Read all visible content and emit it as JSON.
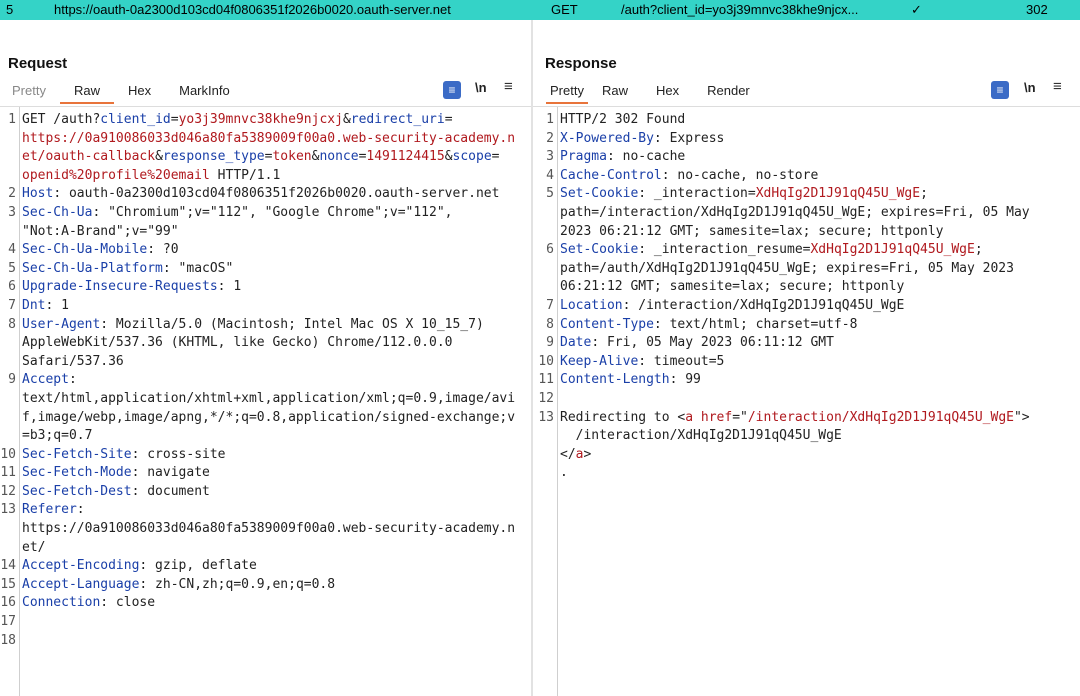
{
  "history": {
    "num": "5",
    "host": "https://oauth-0a2300d103cd04f0806351f2026b0020.oauth-server.net",
    "method": "GET",
    "url": "/auth?client_id=yo3j39mnvc38khe9njcx...",
    "check": "✓",
    "status": "302"
  },
  "request": {
    "title": "Request",
    "tabs": [
      "Pretty",
      "Raw",
      "Hex",
      "MarkInfo"
    ],
    "active_tab": "Raw",
    "newline_label": "\\n",
    "lines": [
      {
        "n": "1",
        "parts": [
          [
            "t",
            "GET /auth?"
          ],
          [
            "pk",
            "client_id"
          ],
          [
            "t",
            "="
          ],
          [
            "pv",
            "yo3j39mnvc38khe9njcxj"
          ],
          [
            "t",
            "&"
          ],
          [
            "pk",
            "redirect_uri"
          ],
          [
            "t",
            "="
          ]
        ]
      },
      {
        "n": "",
        "parts": [
          [
            "pv",
            "https://0a910086033d046a80fa5389009f00a0.web-security-academy.n"
          ]
        ]
      },
      {
        "n": "",
        "parts": [
          [
            "pv",
            "et/oauth-callback"
          ],
          [
            "t",
            "&"
          ],
          [
            "pk",
            "response_type"
          ],
          [
            "t",
            "="
          ],
          [
            "pv",
            "token"
          ],
          [
            "t",
            "&"
          ],
          [
            "pk",
            "nonce"
          ],
          [
            "t",
            "="
          ],
          [
            "pv",
            "1491124415"
          ],
          [
            "t",
            "&"
          ],
          [
            "pk",
            "scope"
          ],
          [
            "t",
            "="
          ]
        ]
      },
      {
        "n": "",
        "parts": [
          [
            "pv",
            "openid%20profile%20email"
          ],
          [
            "t",
            " HTTP/1.1"
          ]
        ]
      },
      {
        "n": "2",
        "parts": [
          [
            "hk",
            "Host"
          ],
          [
            "t",
            ": oauth-0a2300d103cd04f0806351f2026b0020.oauth-server.net"
          ]
        ]
      },
      {
        "n": "3",
        "parts": [
          [
            "hk",
            "Sec-Ch-Ua"
          ],
          [
            "t",
            ": \"Chromium\";v=\"112\", \"Google Chrome\";v=\"112\","
          ]
        ]
      },
      {
        "n": "",
        "parts": [
          [
            "t",
            "\"Not:A-Brand\";v=\"99\""
          ]
        ]
      },
      {
        "n": "4",
        "parts": [
          [
            "hk",
            "Sec-Ch-Ua-Mobile"
          ],
          [
            "t",
            ": ?0"
          ]
        ]
      },
      {
        "n": "5",
        "parts": [
          [
            "hk",
            "Sec-Ch-Ua-Platform"
          ],
          [
            "t",
            ": \"macOS\""
          ]
        ]
      },
      {
        "n": "6",
        "parts": [
          [
            "hk",
            "Upgrade-Insecure-Requests"
          ],
          [
            "t",
            ": 1"
          ]
        ]
      },
      {
        "n": "7",
        "parts": [
          [
            "hk",
            "Dnt"
          ],
          [
            "t",
            ": 1"
          ]
        ]
      },
      {
        "n": "8",
        "parts": [
          [
            "hk",
            "User-Agent"
          ],
          [
            "t",
            ": Mozilla/5.0 (Macintosh; Intel Mac OS X 10_15_7)"
          ]
        ]
      },
      {
        "n": "",
        "parts": [
          [
            "t",
            "AppleWebKit/537.36 (KHTML, like Gecko) Chrome/112.0.0.0"
          ]
        ]
      },
      {
        "n": "",
        "parts": [
          [
            "t",
            "Safari/537.36"
          ]
        ]
      },
      {
        "n": "9",
        "parts": [
          [
            "hk",
            "Accept"
          ],
          [
            "t",
            ":"
          ]
        ]
      },
      {
        "n": "",
        "parts": [
          [
            "t",
            "text/html,application/xhtml+xml,application/xml;q=0.9,image/avi"
          ]
        ]
      },
      {
        "n": "",
        "parts": [
          [
            "t",
            "f,image/webp,image/apng,*/*;q=0.8,application/signed-exchange;v"
          ]
        ]
      },
      {
        "n": "",
        "parts": [
          [
            "t",
            "=b3;q=0.7"
          ]
        ]
      },
      {
        "n": "10",
        "parts": [
          [
            "hk",
            "Sec-Fetch-Site"
          ],
          [
            "t",
            ": cross-site"
          ]
        ]
      },
      {
        "n": "11",
        "parts": [
          [
            "hk",
            "Sec-Fetch-Mode"
          ],
          [
            "t",
            ": navigate"
          ]
        ]
      },
      {
        "n": "12",
        "parts": [
          [
            "hk",
            "Sec-Fetch-Dest"
          ],
          [
            "t",
            ": document"
          ]
        ]
      },
      {
        "n": "13",
        "parts": [
          [
            "hk",
            "Referer"
          ],
          [
            "t",
            ":"
          ]
        ]
      },
      {
        "n": "",
        "parts": [
          [
            "t",
            "https://0a910086033d046a80fa5389009f00a0.web-security-academy.n"
          ]
        ]
      },
      {
        "n": "",
        "parts": [
          [
            "t",
            "et/"
          ]
        ]
      },
      {
        "n": "14",
        "parts": [
          [
            "hk",
            "Accept-Encoding"
          ],
          [
            "t",
            ": gzip, deflate"
          ]
        ]
      },
      {
        "n": "15",
        "parts": [
          [
            "hk",
            "Accept-Language"
          ],
          [
            "t",
            ": zh-CN,zh;q=0.9,en;q=0.8"
          ]
        ]
      },
      {
        "n": "16",
        "parts": [
          [
            "hk",
            "Connection"
          ],
          [
            "t",
            ": close"
          ]
        ]
      },
      {
        "n": "17",
        "parts": []
      },
      {
        "n": "18",
        "parts": []
      }
    ]
  },
  "response": {
    "title": "Response",
    "tabs": [
      "Pretty",
      "Raw",
      "Hex",
      "Render"
    ],
    "active_tab": "Pretty",
    "newline_label": "\\n",
    "lines": [
      {
        "n": "1",
        "parts": [
          [
            "t",
            "HTTP/2 302 Found"
          ]
        ]
      },
      {
        "n": "2",
        "parts": [
          [
            "hk",
            "X-Powered-By"
          ],
          [
            "t",
            ": Express"
          ]
        ]
      },
      {
        "n": "3",
        "parts": [
          [
            "hk",
            "Pragma"
          ],
          [
            "t",
            ": no-cache"
          ]
        ]
      },
      {
        "n": "4",
        "parts": [
          [
            "hk",
            "Cache-Control"
          ],
          [
            "t",
            ": no-cache, no-store"
          ]
        ]
      },
      {
        "n": "5",
        "parts": [
          [
            "hk",
            "Set-Cookie"
          ],
          [
            "t",
            ": _interaction="
          ],
          [
            "pv",
            "XdHqIg2D1J91qQ45U_WgE"
          ],
          [
            "t",
            ";"
          ]
        ]
      },
      {
        "n": "",
        "parts": [
          [
            "t",
            "path=/interaction/XdHqIg2D1J91qQ45U_WgE; expires=Fri, 05 May"
          ]
        ]
      },
      {
        "n": "",
        "parts": [
          [
            "t",
            "2023 06:21:12 GMT; samesite=lax; secure; httponly"
          ]
        ]
      },
      {
        "n": "6",
        "parts": [
          [
            "hk",
            "Set-Cookie"
          ],
          [
            "t",
            ": _interaction_resume="
          ],
          [
            "pv",
            "XdHqIg2D1J91qQ45U_WgE"
          ],
          [
            "t",
            ";"
          ]
        ]
      },
      {
        "n": "",
        "parts": [
          [
            "t",
            "path=/auth/XdHqIg2D1J91qQ45U_WgE; expires=Fri, 05 May 2023"
          ]
        ]
      },
      {
        "n": "",
        "parts": [
          [
            "t",
            "06:21:12 GMT; samesite=lax; secure; httponly"
          ]
        ]
      },
      {
        "n": "7",
        "parts": [
          [
            "hk",
            "Location"
          ],
          [
            "t",
            ": /interaction/XdHqIg2D1J91qQ45U_WgE"
          ]
        ]
      },
      {
        "n": "8",
        "parts": [
          [
            "hk",
            "Content-Type"
          ],
          [
            "t",
            ": text/html; charset=utf-8"
          ]
        ]
      },
      {
        "n": "9",
        "parts": [
          [
            "hk",
            "Date"
          ],
          [
            "t",
            ": Fri, 05 May 2023 06:11:12 GMT"
          ]
        ]
      },
      {
        "n": "10",
        "parts": [
          [
            "hk",
            "Keep-Alive"
          ],
          [
            "t",
            ": timeout=5"
          ]
        ]
      },
      {
        "n": "11",
        "parts": [
          [
            "hk",
            "Content-Length"
          ],
          [
            "t",
            ": 99"
          ]
        ]
      },
      {
        "n": "12",
        "parts": []
      },
      {
        "n": "13",
        "parts": [
          [
            "t",
            "Redirecting to <"
          ],
          [
            "tg",
            "a"
          ],
          [
            "t",
            " "
          ],
          [
            "tg",
            "href"
          ],
          [
            "t",
            "=\""
          ],
          [
            "str",
            "/interaction/XdHqIg2D1J91qQ45U_WgE"
          ],
          [
            "t",
            "\">"
          ]
        ]
      },
      {
        "n": "",
        "parts": [
          [
            "t",
            "  /interaction/XdHqIg2D1J91qQ45U_WgE"
          ]
        ]
      },
      {
        "n": "",
        "parts": [
          [
            "t",
            "</"
          ],
          [
            "tg",
            "a"
          ],
          [
            "t",
            ">"
          ]
        ]
      },
      {
        "n": "",
        "parts": [
          [
            "t",
            "."
          ]
        ]
      }
    ]
  },
  "icons": {
    "wrap": "wrap-lines-icon",
    "menu": "hamburger-menu-icon",
    "layout": [
      "side-by-side-icon",
      "stacked-icon",
      "single-pane-icon"
    ]
  },
  "colors": {
    "history_highlight": "#34d3c7",
    "active_tab_underline": "#e8743b",
    "header_name": "#1a3fa8",
    "param_value": "#b0191e",
    "button_blue": "#3b6bc6"
  }
}
